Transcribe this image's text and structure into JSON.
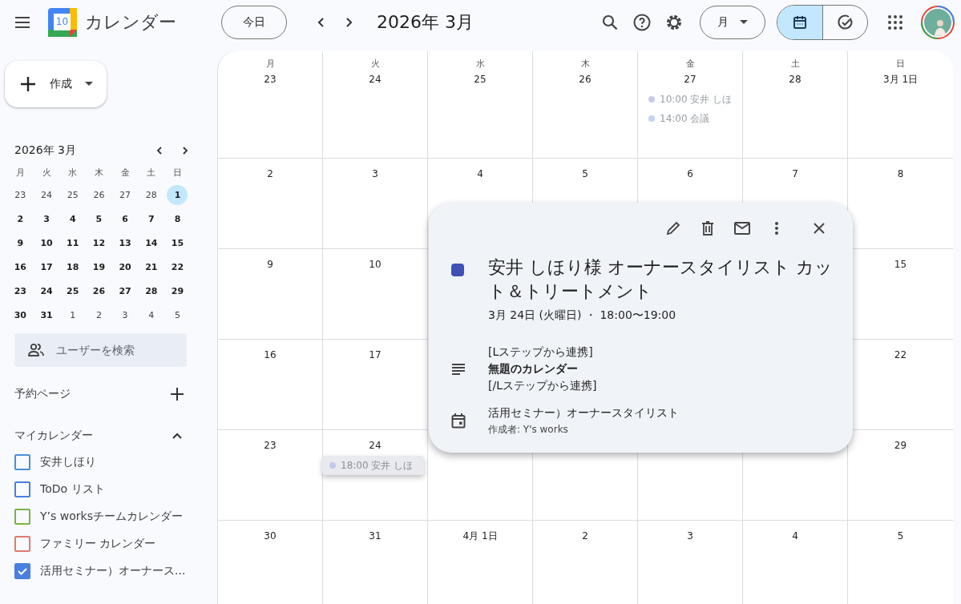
{
  "app": {
    "logo_day": "10",
    "title": "カレンダー"
  },
  "toolbar": {
    "today": "今日",
    "period": "2026年 3月",
    "view": "月",
    "modes": [
      {
        "kind": "calendar",
        "selected": true
      },
      {
        "kind": "tasks",
        "selected": false
      }
    ]
  },
  "create": {
    "label": "作成"
  },
  "mini_calendar": {
    "title": "2026年 3月",
    "weekdays": [
      "月",
      "火",
      "水",
      "木",
      "金",
      "土",
      "日"
    ],
    "days": [
      {
        "label": "23",
        "other_month": true,
        "selected": false
      },
      {
        "label": "24",
        "other_month": true,
        "selected": false
      },
      {
        "label": "25",
        "other_month": true,
        "selected": false
      },
      {
        "label": "26",
        "other_month": true,
        "selected": false
      },
      {
        "label": "27",
        "other_month": true,
        "selected": false
      },
      {
        "label": "28",
        "other_month": true,
        "selected": false
      },
      {
        "label": "1",
        "other_month": false,
        "selected": true
      },
      {
        "label": "2",
        "other_month": false,
        "selected": false
      },
      {
        "label": "3",
        "other_month": false,
        "selected": false
      },
      {
        "label": "4",
        "other_month": false,
        "selected": false
      },
      {
        "label": "5",
        "other_month": false,
        "selected": false
      },
      {
        "label": "6",
        "other_month": false,
        "selected": false
      },
      {
        "label": "7",
        "other_month": false,
        "selected": false
      },
      {
        "label": "8",
        "other_month": false,
        "selected": false
      },
      {
        "label": "9",
        "other_month": false,
        "selected": false
      },
      {
        "label": "10",
        "other_month": false,
        "selected": false
      },
      {
        "label": "11",
        "other_month": false,
        "selected": false
      },
      {
        "label": "12",
        "other_month": false,
        "selected": false
      },
      {
        "label": "13",
        "other_month": false,
        "selected": false
      },
      {
        "label": "14",
        "other_month": false,
        "selected": false
      },
      {
        "label": "15",
        "other_month": false,
        "selected": false
      },
      {
        "label": "16",
        "other_month": false,
        "selected": false
      },
      {
        "label": "17",
        "other_month": false,
        "selected": false
      },
      {
        "label": "18",
        "other_month": false,
        "selected": false
      },
      {
        "label": "19",
        "other_month": false,
        "selected": false
      },
      {
        "label": "20",
        "other_month": false,
        "selected": false
      },
      {
        "label": "21",
        "other_month": false,
        "selected": false
      },
      {
        "label": "22",
        "other_month": false,
        "selected": false
      },
      {
        "label": "23",
        "other_month": false,
        "selected": false
      },
      {
        "label": "24",
        "other_month": false,
        "selected": false
      },
      {
        "label": "25",
        "other_month": false,
        "selected": false
      },
      {
        "label": "26",
        "other_month": false,
        "selected": false
      },
      {
        "label": "27",
        "other_month": false,
        "selected": false
      },
      {
        "label": "28",
        "other_month": false,
        "selected": false
      },
      {
        "label": "29",
        "other_month": false,
        "selected": false
      },
      {
        "label": "30",
        "other_month": false,
        "selected": false
      },
      {
        "label": "31",
        "other_month": false,
        "selected": false
      },
      {
        "label": "1",
        "other_month": true,
        "selected": false
      },
      {
        "label": "2",
        "other_month": true,
        "selected": false
      },
      {
        "label": "3",
        "other_month": true,
        "selected": false
      },
      {
        "label": "4",
        "other_month": true,
        "selected": false
      },
      {
        "label": "5",
        "other_month": true,
        "selected": false
      }
    ]
  },
  "people_search": {
    "placeholder": "ユーザーを検索"
  },
  "booking": {
    "label": "予約ページ"
  },
  "my_calendars": {
    "label": "マイカレンダー",
    "expanded": true,
    "items": [
      {
        "name": "安井しほり",
        "color": "#4a90d9",
        "checked": false
      },
      {
        "name": "ToDo リスト",
        "color": "#4a7fe0",
        "checked": false
      },
      {
        "name": "Y’s worksチームカレンダー",
        "color": "#7cb342",
        "checked": false
      },
      {
        "name": "ファミリー カレンダー",
        "color": "#e07a6a",
        "checked": false
      },
      {
        "name": "活用セミナー）オーナース...",
        "color": "#4a7fe0",
        "checked": true
      }
    ]
  },
  "month_grid": {
    "weeks": [
      [
        {
          "weekday": "月",
          "date": "23"
        },
        {
          "weekday": "火",
          "date": "24"
        },
        {
          "weekday": "水",
          "date": "25"
        },
        {
          "weekday": "木",
          "date": "26"
        },
        {
          "weekday": "金",
          "date": "27",
          "events": [
            {
              "text": "10:00 安井 しほ",
              "color": "#c5cae9",
              "dragging": false
            },
            {
              "text": "14:00 会議",
              "color": "#c5d3f2",
              "dragging": false
            }
          ]
        },
        {
          "weekday": "土",
          "date": "28"
        },
        {
          "weekday": "日",
          "date": "3月 1日"
        }
      ],
      [
        {
          "date": "2"
        },
        {
          "date": "3"
        },
        {
          "date": "4"
        },
        {
          "date": "5"
        },
        {
          "date": "6"
        },
        {
          "date": "7"
        },
        {
          "date": "8"
        }
      ],
      [
        {
          "date": "9"
        },
        {
          "date": "10"
        },
        {
          "date": "15"
        }
      ],
      [
        {
          "date": "16"
        },
        {
          "date": "17"
        },
        {
          "date": "22"
        }
      ],
      [
        {
          "date": "23"
        },
        {
          "date": "24",
          "events": [
            {
              "text": "18:00 安井 しほ",
              "color": "#c5cae9",
              "dragging": true
            }
          ]
        },
        {
          "date": "29"
        }
      ],
      [
        {
          "date": "30"
        },
        {
          "date": "31"
        },
        {
          "date": "4月 1日"
        },
        {
          "date": "2"
        },
        {
          "date": "3"
        },
        {
          "date": "4"
        },
        {
          "date": "5"
        }
      ]
    ]
  },
  "event_popup": {
    "color": "#3f51b5",
    "title": "安井 しほり様 オーナースタイリスト カット＆トリートメント",
    "when": "3月 24日 (火曜日) ・ 18:00〜19:00",
    "description": [
      {
        "text": "[Lステップから連携]",
        "bold": false
      },
      {
        "text": "無題のカレンダー",
        "bold": true
      },
      {
        "text": "[/Lステップから連携]",
        "bold": false
      }
    ],
    "calendar": "活用セミナー）オーナースタイリスト",
    "creator": "作成者: Y's works"
  }
}
